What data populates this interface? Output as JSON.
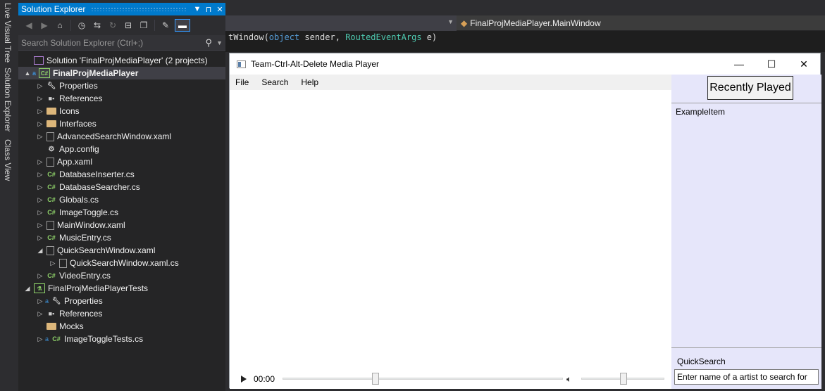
{
  "vertical_tabs": [
    "Live Visual Tree",
    "Solution Explorer",
    "Class View"
  ],
  "solution_explorer": {
    "title": "Solution Explorer",
    "title_buttons": [
      "▼",
      "⊓",
      "✕"
    ],
    "search_placeholder": "Search Solution Explorer (Ctrl+;)",
    "tree": [
      {
        "label": "Solution 'FinalProjMediaPlayer' (2 projects)",
        "icon": "solution-icon",
        "level": 0,
        "arrow": ""
      },
      {
        "label": "FinalProjMediaPlayer",
        "icon": "csharp-project-icon",
        "level": 0,
        "arrow": "▲",
        "selected": true
      },
      {
        "label": "Properties",
        "icon": "wrench-icon",
        "level": 1,
        "arrow": "▷"
      },
      {
        "label": "References",
        "icon": "references-icon",
        "level": 1,
        "arrow": "▷"
      },
      {
        "label": "Icons",
        "icon": "folder-icon",
        "level": 1,
        "arrow": "▷"
      },
      {
        "label": "Interfaces",
        "icon": "folder-icon",
        "level": 1,
        "arrow": "▷"
      },
      {
        "label": "AdvancedSearchWindow.xaml",
        "icon": "xaml-file-icon",
        "level": 1,
        "arrow": "▷"
      },
      {
        "label": "App.config",
        "icon": "config-file-icon",
        "level": 1,
        "arrow": ""
      },
      {
        "label": "App.xaml",
        "icon": "xaml-file-icon",
        "level": 1,
        "arrow": "▷"
      },
      {
        "label": "DatabaseInserter.cs",
        "icon": "csharp-file-icon",
        "level": 1,
        "arrow": "▷"
      },
      {
        "label": "DatabaseSearcher.cs",
        "icon": "csharp-file-icon",
        "level": 1,
        "arrow": "▷"
      },
      {
        "label": "Globals.cs",
        "icon": "csharp-file-icon",
        "level": 1,
        "arrow": "▷"
      },
      {
        "label": "ImageToggle.cs",
        "icon": "csharp-file-icon",
        "level": 1,
        "arrow": "▷"
      },
      {
        "label": "MainWindow.xaml",
        "icon": "xaml-file-icon",
        "level": 1,
        "arrow": "▷"
      },
      {
        "label": "MusicEntry.cs",
        "icon": "csharp-file-icon",
        "level": 1,
        "arrow": "▷"
      },
      {
        "label": "QuickSearchWindow.xaml",
        "icon": "xaml-file-icon",
        "level": 1,
        "arrow": "◢"
      },
      {
        "label": "QuickSearchWindow.xaml.cs",
        "icon": "xaml-cs-file-icon",
        "level": 2,
        "arrow": "▷"
      },
      {
        "label": "VideoEntry.cs",
        "icon": "csharp-file-icon",
        "level": 1,
        "arrow": "▷"
      },
      {
        "label": "FinalProjMediaPlayerTests",
        "icon": "test-project-icon",
        "level": 0,
        "arrow": "◢"
      },
      {
        "label": "Properties",
        "icon": "wrench-icon",
        "level": 1,
        "arrow": "▷",
        "locked": true
      },
      {
        "label": "References",
        "icon": "references-icon",
        "level": 1,
        "arrow": "▷"
      },
      {
        "label": "Mocks",
        "icon": "folder-icon",
        "level": 1,
        "arrow": ""
      },
      {
        "label": "ImageToggleTests.cs",
        "icon": "csharp-file-icon",
        "level": 1,
        "arrow": "▷",
        "locked": true
      }
    ]
  },
  "editor": {
    "nav_right": "FinalProjMediaPlayer.MainWindow",
    "code_prefix": "tWindow(",
    "code_kw1": "object",
    "code_mid1": " sender, ",
    "code_type": "RoutedEventArgs",
    "code_end": " e)"
  },
  "app": {
    "title": "Team-Ctrl-Alt-Delete Media Player",
    "controls": {
      "minimize": "—",
      "maximize": "☐",
      "close": "✕"
    },
    "menu": [
      "File",
      "Search",
      "Help"
    ],
    "player": {
      "time": "00:00",
      "progress": 0.33,
      "volume": 0.5
    },
    "recently_played_label": "Recently Played",
    "recent_items": [
      "ExampleItem"
    ],
    "quicksearch_label": "QuickSearch",
    "quicksearch_value": "Enter name of a artist to search for"
  }
}
